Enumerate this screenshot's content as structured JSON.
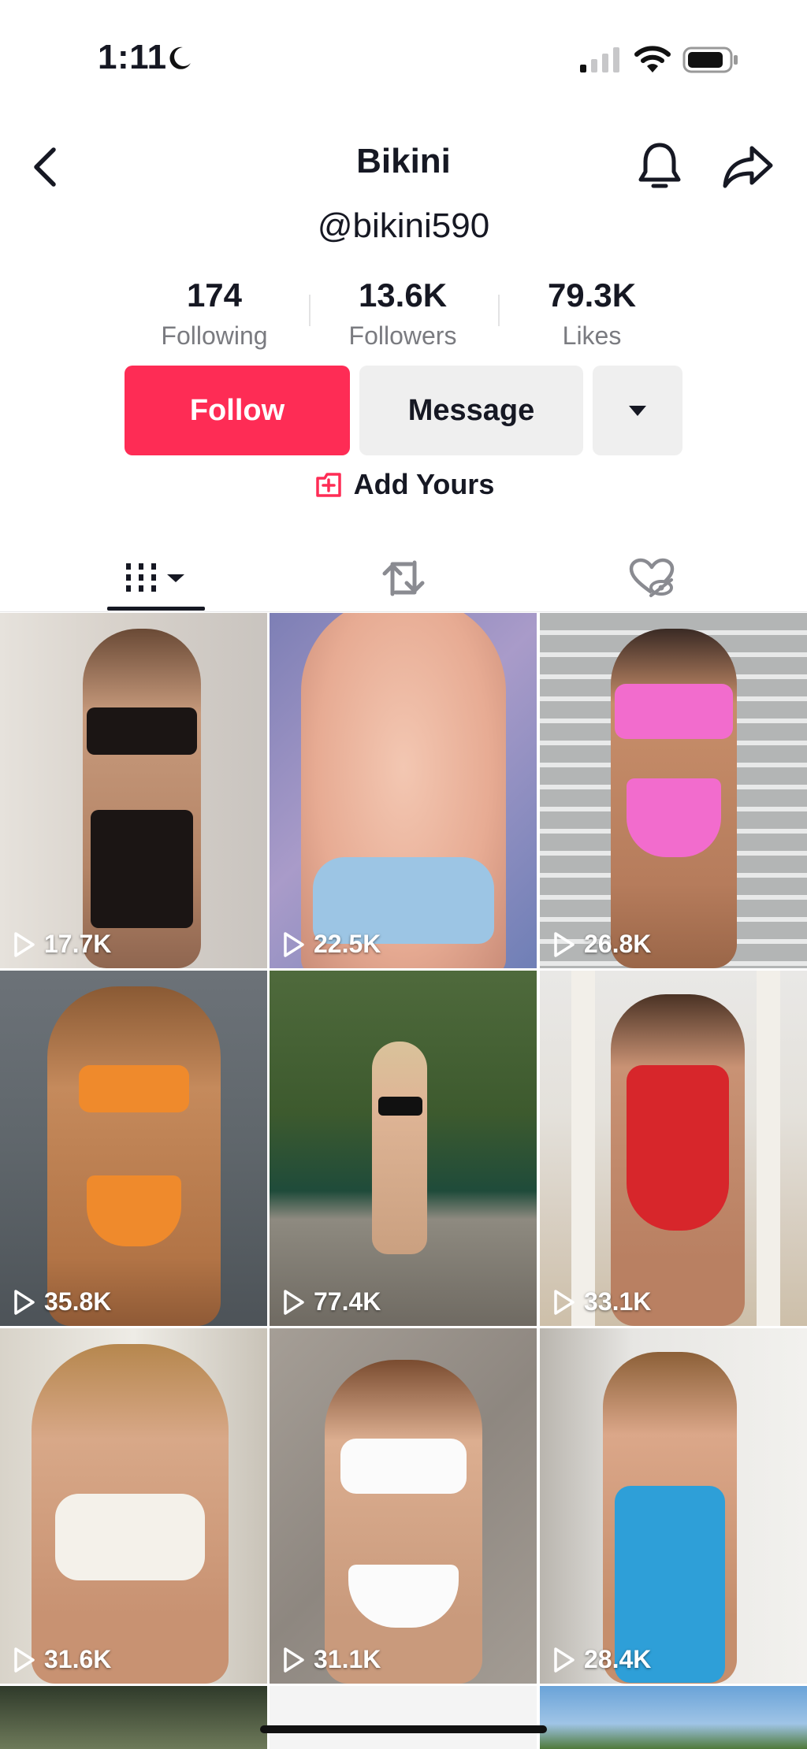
{
  "status_bar": {
    "time": "1:11",
    "icons": [
      "moon-icon",
      "cellular-signal-icon",
      "wifi-icon",
      "battery-icon"
    ]
  },
  "header": {
    "title": "Bikini",
    "handle": "@bikini590",
    "icons": [
      "back-chevron-icon",
      "bell-icon",
      "share-arrow-icon"
    ]
  },
  "stats": [
    {
      "value": "174",
      "label": "Following"
    },
    {
      "value": "13.6K",
      "label": "Followers"
    },
    {
      "value": "79.3K",
      "label": "Likes"
    }
  ],
  "actions": {
    "follow_label": "Follow",
    "message_label": "Message",
    "more_icon": "caret-down-icon",
    "add_yours_label": "Add Yours"
  },
  "tabs": [
    {
      "name": "videos",
      "icon": "grid-columns-icon",
      "active": true
    },
    {
      "name": "reposts",
      "icon": "repost-icon",
      "active": false
    },
    {
      "name": "liked",
      "icon": "hidden-heart-icon",
      "active": false
    }
  ],
  "videos": [
    {
      "views": "17.7K"
    },
    {
      "views": "22.5K"
    },
    {
      "views": "26.8K"
    },
    {
      "views": "35.8K"
    },
    {
      "views": "77.4K"
    },
    {
      "views": "33.1K"
    },
    {
      "views": "31.6K"
    },
    {
      "views": "31.1K"
    },
    {
      "views": "28.4K"
    }
  ],
  "colors": {
    "follow_button": "#fe2c55",
    "secondary_button": "#efefef",
    "text_primary": "#161823",
    "text_secondary": "#7a7b80"
  }
}
